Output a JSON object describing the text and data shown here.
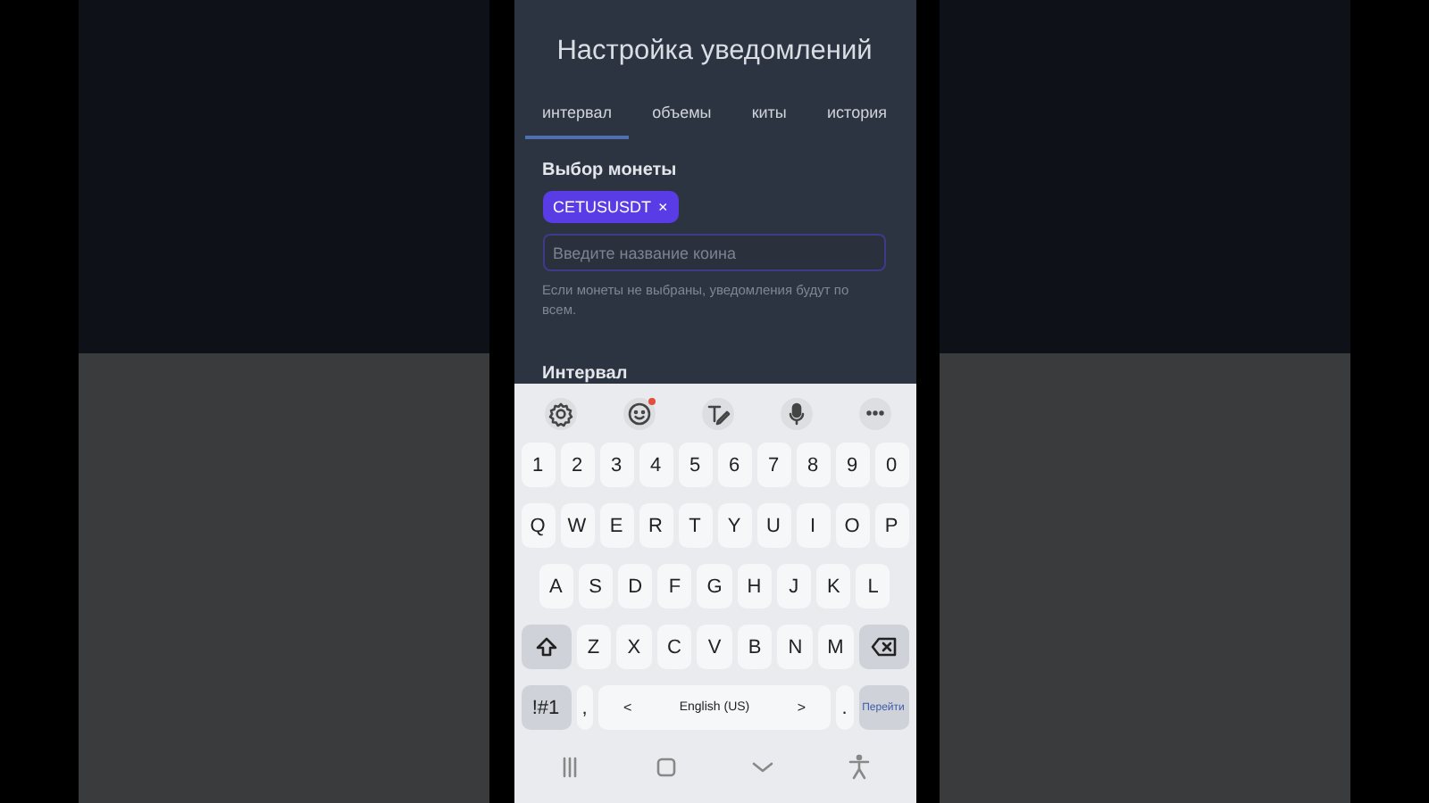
{
  "screen": {
    "title": "Настройка уведомлений",
    "tabs": [
      {
        "label": "интервал",
        "selected": true
      },
      {
        "label": "объемы",
        "selected": false
      },
      {
        "label": "киты",
        "selected": false
      },
      {
        "label": "история",
        "selected": false
      }
    ],
    "coin_section": {
      "label": "Выбор монеты",
      "chips": [
        {
          "text": "CETUSUSDT",
          "remove": "×"
        }
      ],
      "input": {
        "placeholder": "Введите название коина"
      },
      "hint": "Если монеты не выбраны, уведомления будут по всем."
    },
    "interval_label": "Интервал"
  },
  "keyboard": {
    "toolbar": [
      {
        "kind": "settings"
      },
      {
        "kind": "emoji",
        "badge": true
      },
      {
        "kind": "handwriting"
      },
      {
        "kind": "mic"
      },
      {
        "kind": "more"
      }
    ],
    "key_rows": [
      {
        "keys": [
          {
            "kind": "char",
            "label": "1"
          },
          {
            "kind": "char",
            "label": "2"
          },
          {
            "kind": "char",
            "label": "3"
          },
          {
            "kind": "char",
            "label": "4"
          },
          {
            "kind": "char",
            "label": "5"
          },
          {
            "kind": "char",
            "label": "6"
          },
          {
            "kind": "char",
            "label": "7"
          },
          {
            "kind": "char",
            "label": "8"
          },
          {
            "kind": "char",
            "label": "9"
          },
          {
            "kind": "char",
            "label": "0"
          }
        ]
      },
      {
        "keys": [
          {
            "kind": "char",
            "label": "Q"
          },
          {
            "kind": "char",
            "label": "W"
          },
          {
            "kind": "char",
            "label": "E"
          },
          {
            "kind": "char",
            "label": "R"
          },
          {
            "kind": "char",
            "label": "T"
          },
          {
            "kind": "char",
            "label": "Y"
          },
          {
            "kind": "char",
            "label": "U"
          },
          {
            "kind": "char",
            "label": "I"
          },
          {
            "kind": "char",
            "label": "O"
          },
          {
            "kind": "char",
            "label": "P"
          }
        ]
      },
      {
        "keys": [
          {
            "kind": "char",
            "label": "A"
          },
          {
            "kind": "char",
            "label": "S"
          },
          {
            "kind": "char",
            "label": "D"
          },
          {
            "kind": "char",
            "label": "F"
          },
          {
            "kind": "char",
            "label": "G"
          },
          {
            "kind": "char",
            "label": "H"
          },
          {
            "kind": "char",
            "label": "J"
          },
          {
            "kind": "char",
            "label": "K"
          },
          {
            "kind": "char",
            "label": "L"
          }
        ]
      },
      {
        "keys": [
          {
            "kind": "shift"
          },
          {
            "kind": "char",
            "label": "Z"
          },
          {
            "kind": "char",
            "label": "X"
          },
          {
            "kind": "char",
            "label": "C"
          },
          {
            "kind": "char",
            "label": "V"
          },
          {
            "kind": "char",
            "label": "B"
          },
          {
            "kind": "char",
            "label": "N"
          },
          {
            "kind": "char",
            "label": "M"
          },
          {
            "kind": "backspace"
          }
        ]
      },
      {
        "keys": [
          {
            "kind": "symbols",
            "label": "!#1"
          },
          {
            "kind": "char",
            "label": ","
          },
          {
            "kind": "space",
            "label": "English (US)",
            "left": "<",
            "right": ">"
          },
          {
            "kind": "char",
            "label": "."
          },
          {
            "kind": "action",
            "label": "Перейти"
          }
        ]
      }
    ]
  },
  "nav_bar": [
    {
      "kind": "recents"
    },
    {
      "kind": "home"
    },
    {
      "kind": "hide"
    },
    {
      "kind": "accessibility"
    }
  ]
}
